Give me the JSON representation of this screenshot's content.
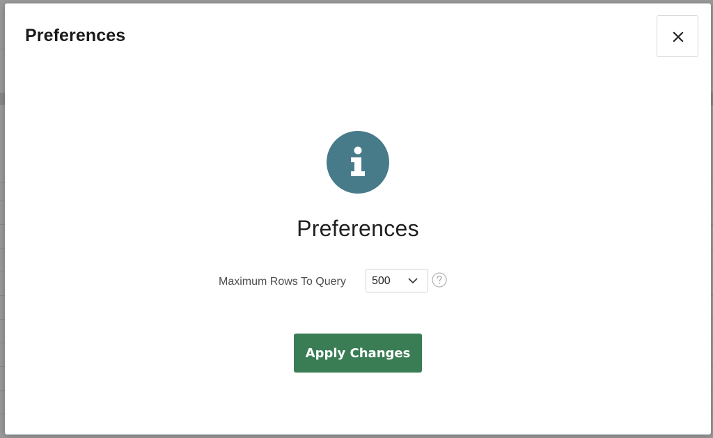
{
  "dialog": {
    "title": "Preferences",
    "close_icon": "close-icon"
  },
  "content": {
    "icon": "info-icon",
    "icon_color": "#477b8a",
    "heading": "Preferences"
  },
  "field": {
    "label": "Maximum Rows To Query",
    "value": "500",
    "help_icon": "help-icon"
  },
  "actions": {
    "apply_label": "Apply Changes",
    "apply_color": "#3a7d55"
  }
}
